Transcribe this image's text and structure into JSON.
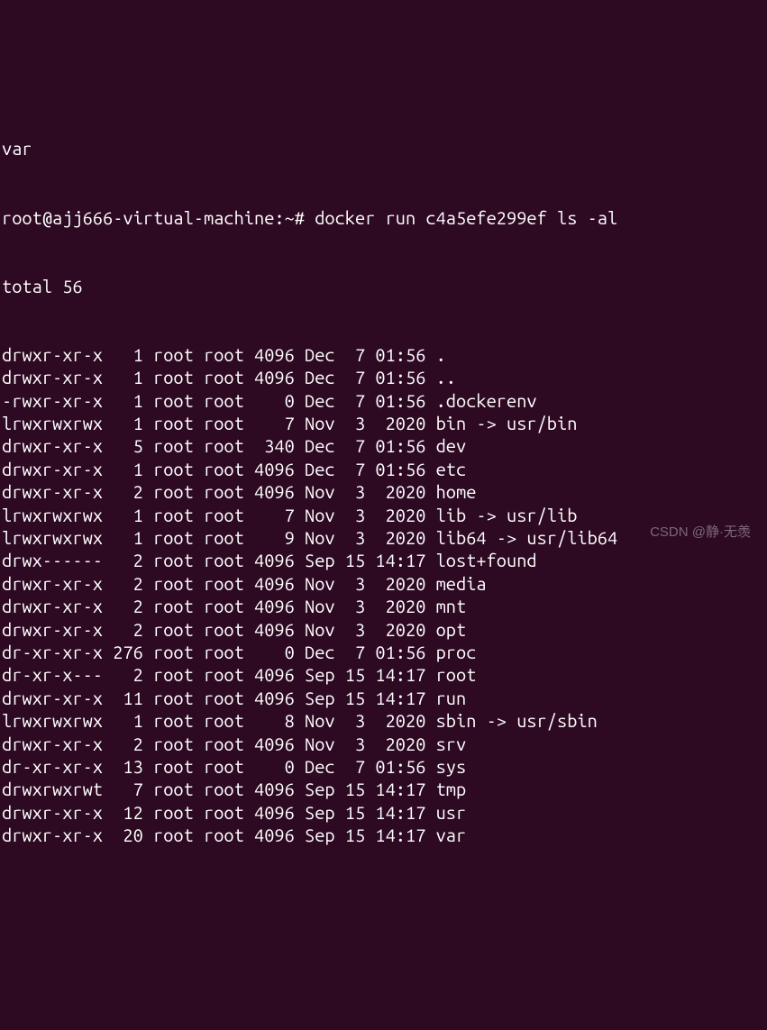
{
  "terminal": {
    "partial_line": "var",
    "prompt": "root@ajj666-virtual-machine:~#",
    "command": "docker run c4a5efe299ef ls -al",
    "total_line": "total 56",
    "entries": [
      {
        "perms": "drwxr-xr-x",
        "links": "1",
        "owner": "root",
        "group": "root",
        "size": "4096",
        "month": "Dec",
        "day": "7",
        "time": "01:56",
        "name": "."
      },
      {
        "perms": "drwxr-xr-x",
        "links": "1",
        "owner": "root",
        "group": "root",
        "size": "4096",
        "month": "Dec",
        "day": "7",
        "time": "01:56",
        "name": ".."
      },
      {
        "perms": "-rwxr-xr-x",
        "links": "1",
        "owner": "root",
        "group": "root",
        "size": "0",
        "month": "Dec",
        "day": "7",
        "time": "01:56",
        "name": ".dockerenv"
      },
      {
        "perms": "lrwxrwxrwx",
        "links": "1",
        "owner": "root",
        "group": "root",
        "size": "7",
        "month": "Nov",
        "day": "3",
        "time": "2020",
        "name": "bin -> usr/bin"
      },
      {
        "perms": "drwxr-xr-x",
        "links": "5",
        "owner": "root",
        "group": "root",
        "size": "340",
        "month": "Dec",
        "day": "7",
        "time": "01:56",
        "name": "dev"
      },
      {
        "perms": "drwxr-xr-x",
        "links": "1",
        "owner": "root",
        "group": "root",
        "size": "4096",
        "month": "Dec",
        "day": "7",
        "time": "01:56",
        "name": "etc"
      },
      {
        "perms": "drwxr-xr-x",
        "links": "2",
        "owner": "root",
        "group": "root",
        "size": "4096",
        "month": "Nov",
        "day": "3",
        "time": "2020",
        "name": "home"
      },
      {
        "perms": "lrwxrwxrwx",
        "links": "1",
        "owner": "root",
        "group": "root",
        "size": "7",
        "month": "Nov",
        "day": "3",
        "time": "2020",
        "name": "lib -> usr/lib"
      },
      {
        "perms": "lrwxrwxrwx",
        "links": "1",
        "owner": "root",
        "group": "root",
        "size": "9",
        "month": "Nov",
        "day": "3",
        "time": "2020",
        "name": "lib64 -> usr/lib64"
      },
      {
        "perms": "drwx------",
        "links": "2",
        "owner": "root",
        "group": "root",
        "size": "4096",
        "month": "Sep",
        "day": "15",
        "time": "14:17",
        "name": "lost+found"
      },
      {
        "perms": "drwxr-xr-x",
        "links": "2",
        "owner": "root",
        "group": "root",
        "size": "4096",
        "month": "Nov",
        "day": "3",
        "time": "2020",
        "name": "media"
      },
      {
        "perms": "drwxr-xr-x",
        "links": "2",
        "owner": "root",
        "group": "root",
        "size": "4096",
        "month": "Nov",
        "day": "3",
        "time": "2020",
        "name": "mnt"
      },
      {
        "perms": "drwxr-xr-x",
        "links": "2",
        "owner": "root",
        "group": "root",
        "size": "4096",
        "month": "Nov",
        "day": "3",
        "time": "2020",
        "name": "opt"
      },
      {
        "perms": "dr-xr-xr-x",
        "links": "276",
        "owner": "root",
        "group": "root",
        "size": "0",
        "month": "Dec",
        "day": "7",
        "time": "01:56",
        "name": "proc"
      },
      {
        "perms": "dr-xr-x---",
        "links": "2",
        "owner": "root",
        "group": "root",
        "size": "4096",
        "month": "Sep",
        "day": "15",
        "time": "14:17",
        "name": "root"
      },
      {
        "perms": "drwxr-xr-x",
        "links": "11",
        "owner": "root",
        "group": "root",
        "size": "4096",
        "month": "Sep",
        "day": "15",
        "time": "14:17",
        "name": "run"
      },
      {
        "perms": "lrwxrwxrwx",
        "links": "1",
        "owner": "root",
        "group": "root",
        "size": "8",
        "month": "Nov",
        "day": "3",
        "time": "2020",
        "name": "sbin -> usr/sbin"
      },
      {
        "perms": "drwxr-xr-x",
        "links": "2",
        "owner": "root",
        "group": "root",
        "size": "4096",
        "month": "Nov",
        "day": "3",
        "time": "2020",
        "name": "srv"
      },
      {
        "perms": "dr-xr-xr-x",
        "links": "13",
        "owner": "root",
        "group": "root",
        "size": "0",
        "month": "Dec",
        "day": "7",
        "time": "01:56",
        "name": "sys"
      },
      {
        "perms": "drwxrwxrwt",
        "links": "7",
        "owner": "root",
        "group": "root",
        "size": "4096",
        "month": "Sep",
        "day": "15",
        "time": "14:17",
        "name": "tmp"
      },
      {
        "perms": "drwxr-xr-x",
        "links": "12",
        "owner": "root",
        "group": "root",
        "size": "4096",
        "month": "Sep",
        "day": "15",
        "time": "14:17",
        "name": "usr"
      },
      {
        "perms": "drwxr-xr-x",
        "links": "20",
        "owner": "root",
        "group": "root",
        "size": "4096",
        "month": "Sep",
        "day": "15",
        "time": "14:17",
        "name": "var"
      }
    ]
  },
  "watermark": "CSDN @静·无羡"
}
